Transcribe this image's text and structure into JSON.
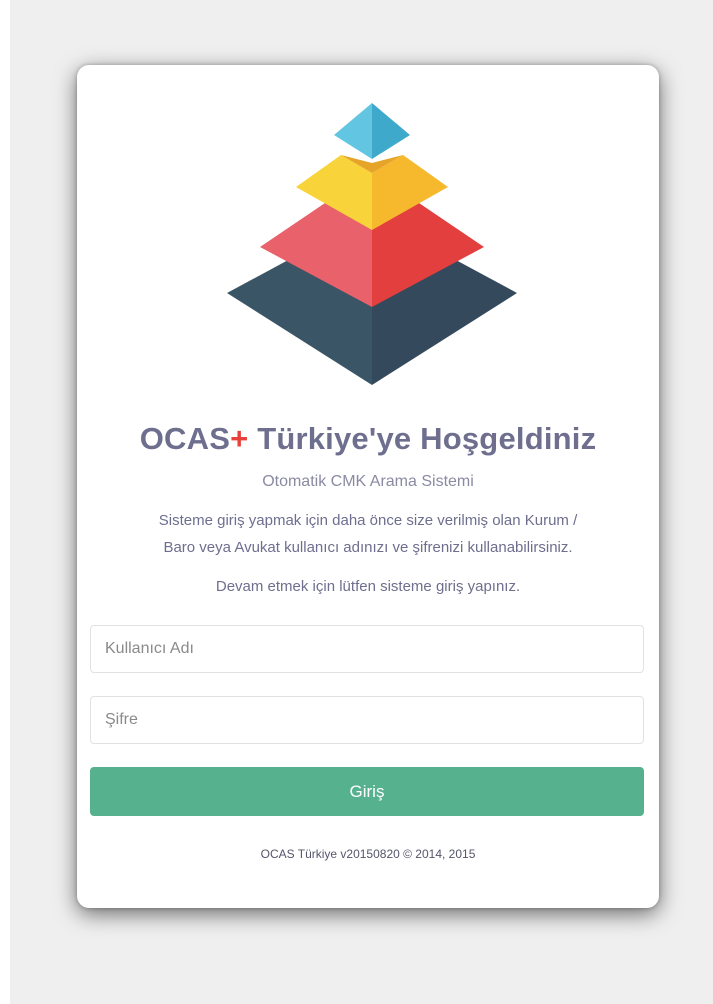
{
  "logo": {
    "icon": "pyramid-logo",
    "colors": {
      "top": "#4bb8d8",
      "second": "#f8c630",
      "third": "#e84a4f",
      "base": "#3e5668"
    }
  },
  "header": {
    "brand": "OCAS",
    "plus": "+",
    "title_rest": " Türkiye'ye Hoşgeldiniz",
    "subtitle": "Otomatik CMK Arama Sistemi"
  },
  "info": {
    "line1": "Sisteme giriş yapmak için daha önce size verilmiş olan Kurum /",
    "line2": "Baro veya Avukat kullanıcı adınızı ve şifrenizi kullanabilirsiniz.",
    "prompt": "Devam etmek için lütfen sisteme giriş yapınız."
  },
  "form": {
    "username_placeholder": "Kullanıcı Adı",
    "username_value": "",
    "password_placeholder": "Şifre",
    "password_value": "",
    "submit_label": "Giriş"
  },
  "footer": {
    "text": "OCAS Türkiye v20150820 © 2014, 2015"
  },
  "colors": {
    "background": "#efefef",
    "card": "#ffffff",
    "text": "#6e6e8f",
    "accent_plus": "#e8413b",
    "button": "#56b18f"
  }
}
